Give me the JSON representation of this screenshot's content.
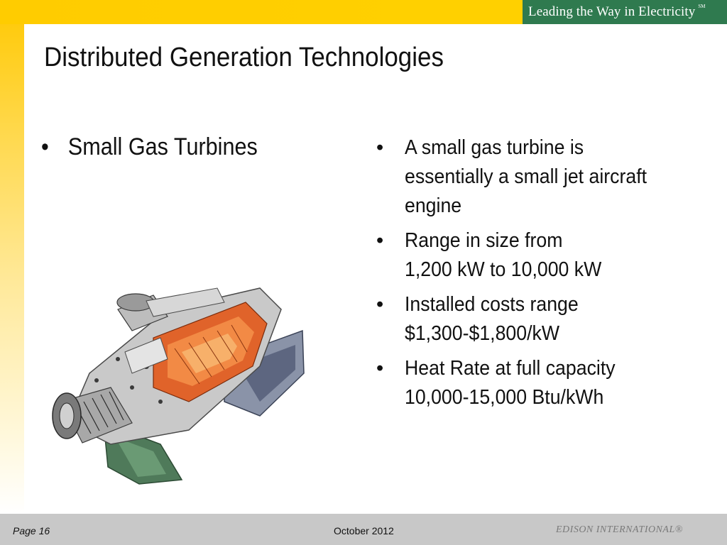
{
  "header": {
    "tagline": "Leading the Way in Electricity",
    "tagline_mark": "SM",
    "accent_color": "#ffcc00",
    "tagline_bg_color": "#2f7a4f"
  },
  "slide": {
    "title": "Distributed Generation Technologies",
    "left_bullets": [
      {
        "bullet": "•",
        "text": "Small Gas Turbines"
      }
    ],
    "right_bullets": [
      {
        "bullet": "•",
        "text": "A small gas turbine is\nessentially a small jet aircraft\nengine"
      },
      {
        "bullet": "•",
        "text": "Range in size from\n1,200 kW to 10,000 kW"
      },
      {
        "bullet": "•",
        "text": "Installed costs range\n$1,300-$1,800/kW"
      },
      {
        "bullet": "•",
        "text": "Heat Rate at full capacity\n10,000-15,000 Btu/kWh"
      }
    ],
    "image": {
      "subject": "gas-turbine-cutaway-illustration"
    }
  },
  "footer": {
    "page_label": "Page  16",
    "date": "October 2012",
    "brand": "EDISON INTERNATIONAL®"
  }
}
